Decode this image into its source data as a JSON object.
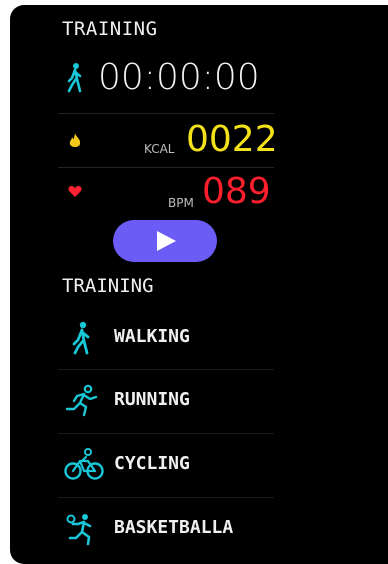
{
  "header": {
    "title": "TRAINING"
  },
  "timer": {
    "value": "00:00:00",
    "icon": "walking-icon"
  },
  "calories": {
    "unit": "KCAL",
    "value": "0022",
    "icon": "flame-icon",
    "color": "#f3e21a"
  },
  "heart_rate": {
    "unit": "BPM",
    "value": "089",
    "icon": "heart-icon",
    "color": "#ff1f2c"
  },
  "play_button": {
    "icon": "play-icon",
    "color": "#6a5cf5"
  },
  "training_list": {
    "title": "TRAINING",
    "items": [
      {
        "label": "WALKING",
        "icon": "walking-icon"
      },
      {
        "label": "RUNNING",
        "icon": "running-icon"
      },
      {
        "label": "CYCLING",
        "icon": "cycling-icon"
      },
      {
        "label": "BASKETBALLA",
        "icon": "basketball-icon"
      }
    ]
  },
  "accent_color": "#19c7d6"
}
